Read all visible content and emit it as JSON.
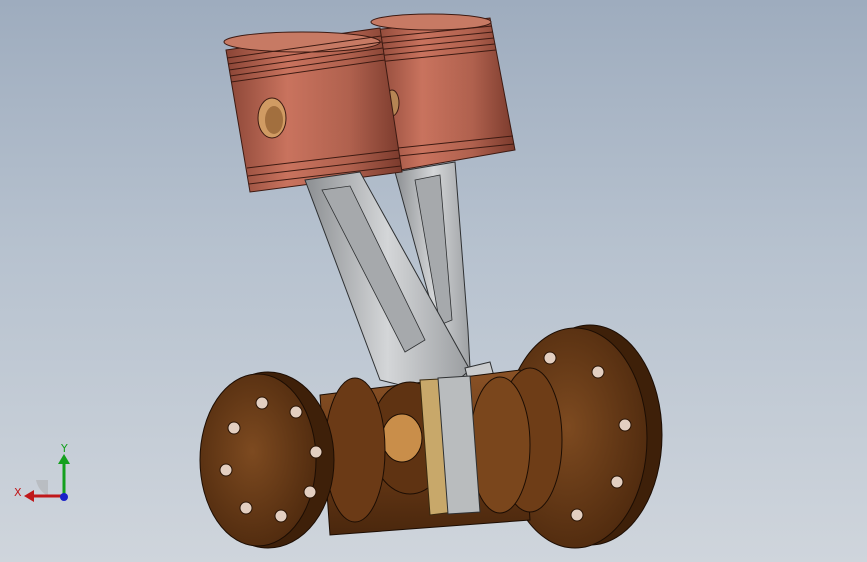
{
  "viewport": {
    "background_top": "#9eacbe",
    "background_bottom": "#cfd5dc"
  },
  "model": {
    "piston_color": "#b0614e",
    "rod_color": "#b8bbbd",
    "crankshaft_color": "#6b3b17",
    "bearing_color": "#c8a86a"
  },
  "triad": {
    "x_label": "X",
    "y_label": "Y",
    "x_color": "#c0181a",
    "y_color": "#14a01e",
    "origin_color": "#1a22c8"
  }
}
